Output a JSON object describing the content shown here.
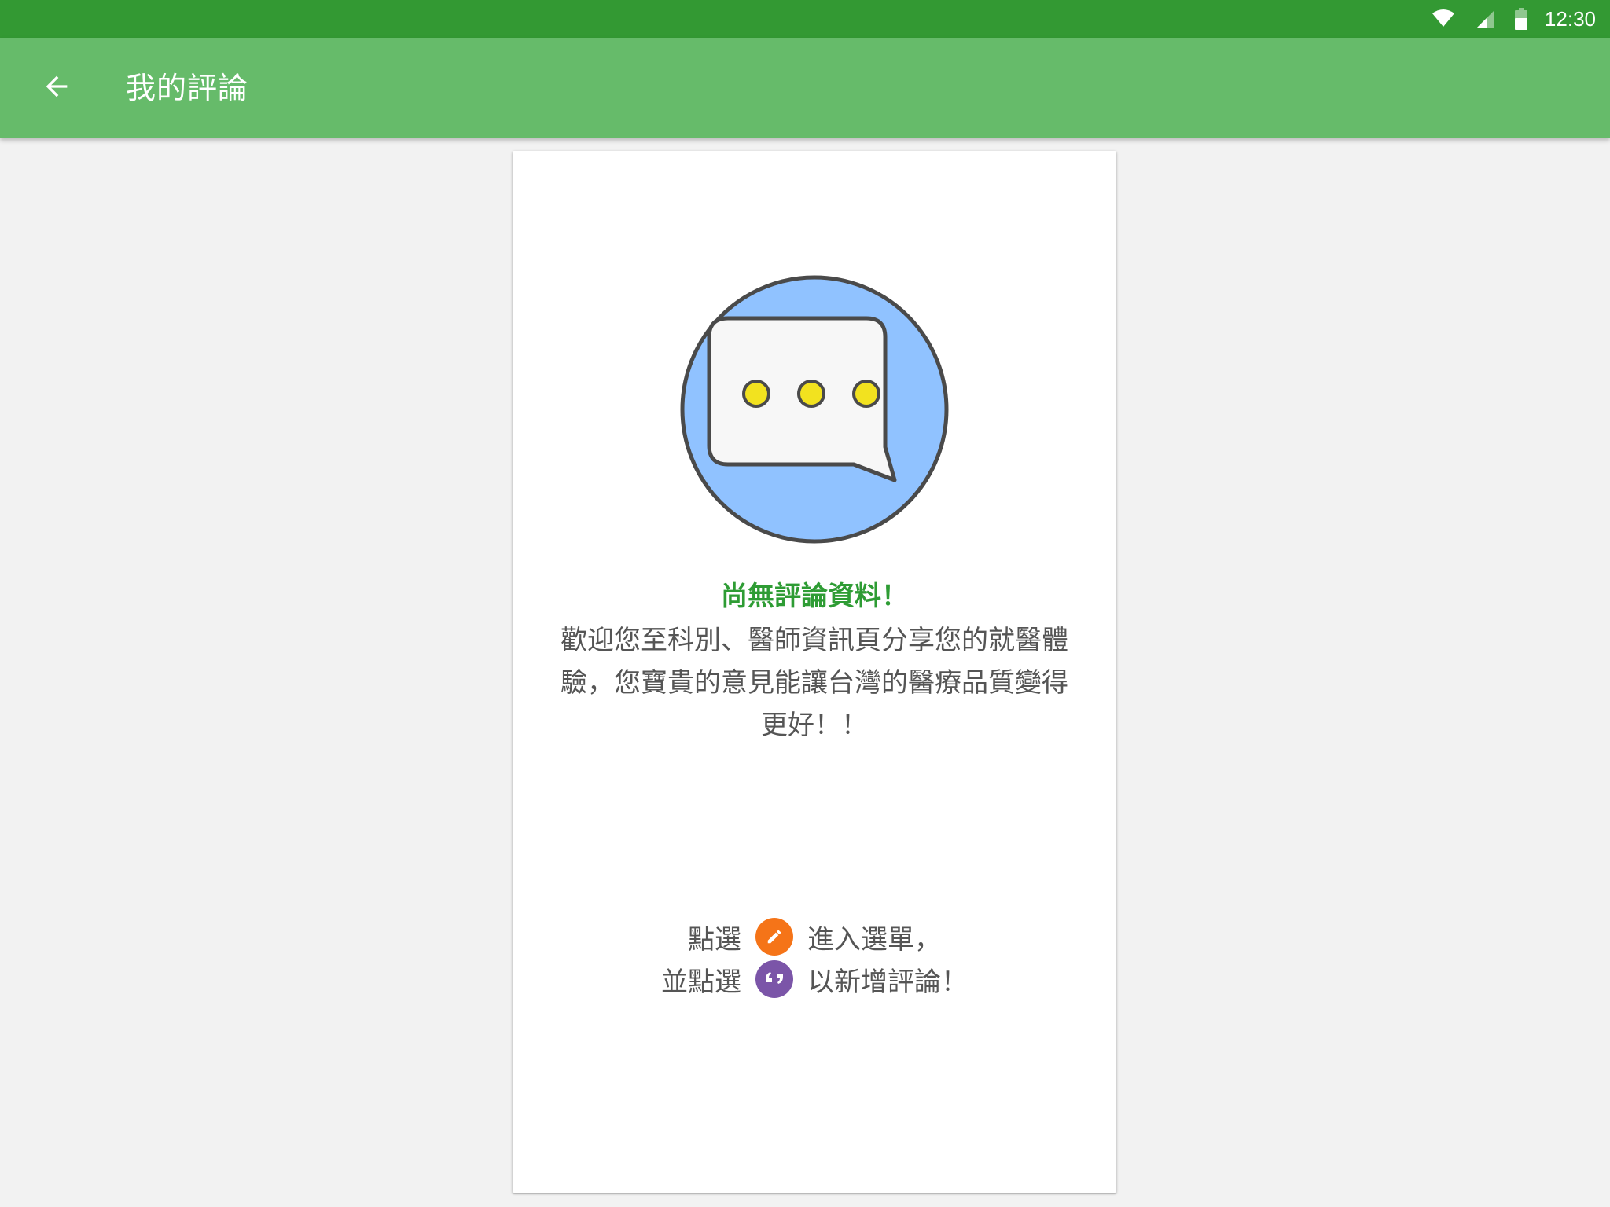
{
  "status_bar": {
    "time": "12:30",
    "icons": [
      "wifi-icon",
      "cell-signal-icon",
      "battery-icon"
    ],
    "color": "#339933"
  },
  "app_bar": {
    "back_icon": "arrow-left-icon",
    "title": "我的評論",
    "color": "#66bb6a"
  },
  "empty_state": {
    "illustration": "chat-bubble-icon",
    "title": "尚無評論資料！",
    "message": "歡迎您至科別、醫師資訊頁分享您的就醫體驗，您寶貴的意見能讓台灣的醫療品質變得更好！！",
    "instruction_1": {
      "before": "點選",
      "icon": "pencil-icon",
      "icon_color": "#f57418",
      "after": "進入選單，"
    },
    "instruction_2": {
      "before": "並點選",
      "icon": "quote-icon",
      "icon_color": "#7b55a8",
      "after": "以新增評論！"
    }
  }
}
